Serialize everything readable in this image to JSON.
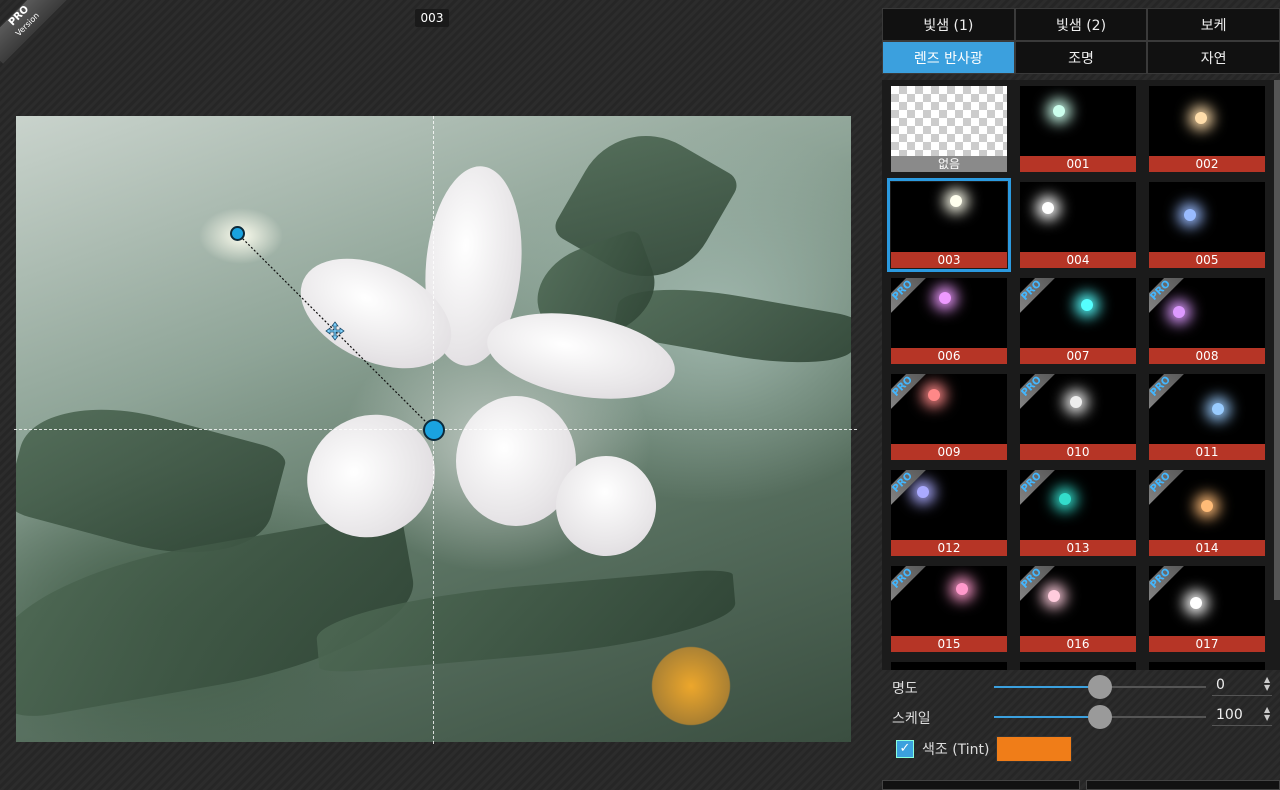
{
  "badge": {
    "main": "PRO",
    "sub": "Version"
  },
  "canvas": {
    "current_preset": "003"
  },
  "tabs_row1": [
    "빛샘 (1)",
    "빛샘 (2)",
    "보케"
  ],
  "tabs_row2": [
    "렌즈 반사광",
    "조명",
    "자연"
  ],
  "active_tab": "렌즈 반사광",
  "presets": [
    {
      "label": "없음",
      "pro": false
    },
    {
      "label": "001",
      "pro": false
    },
    {
      "label": "002",
      "pro": false
    },
    {
      "label": "003",
      "pro": false,
      "selected": true
    },
    {
      "label": "004",
      "pro": false
    },
    {
      "label": "005",
      "pro": false
    },
    {
      "label": "006",
      "pro": true
    },
    {
      "label": "007",
      "pro": true
    },
    {
      "label": "008",
      "pro": true
    },
    {
      "label": "009",
      "pro": true
    },
    {
      "label": "010",
      "pro": true
    },
    {
      "label": "011",
      "pro": true
    },
    {
      "label": "012",
      "pro": true
    },
    {
      "label": "013",
      "pro": true
    },
    {
      "label": "014",
      "pro": true
    },
    {
      "label": "015",
      "pro": true
    },
    {
      "label": "016",
      "pro": true
    },
    {
      "label": "017",
      "pro": true
    }
  ],
  "pro_tag": "PRO",
  "controls": {
    "brightness": {
      "label": "명도",
      "value": "0",
      "fraction": 0.5
    },
    "scale": {
      "label": "스케일",
      "value": "100",
      "fraction": 0.5
    },
    "tint": {
      "label": "색조 (Tint)",
      "checked": true,
      "color": "#f07d18"
    }
  },
  "colors": {
    "accent": "#3ba0de",
    "caption": "#b63526",
    "tint": "#f07d18"
  }
}
